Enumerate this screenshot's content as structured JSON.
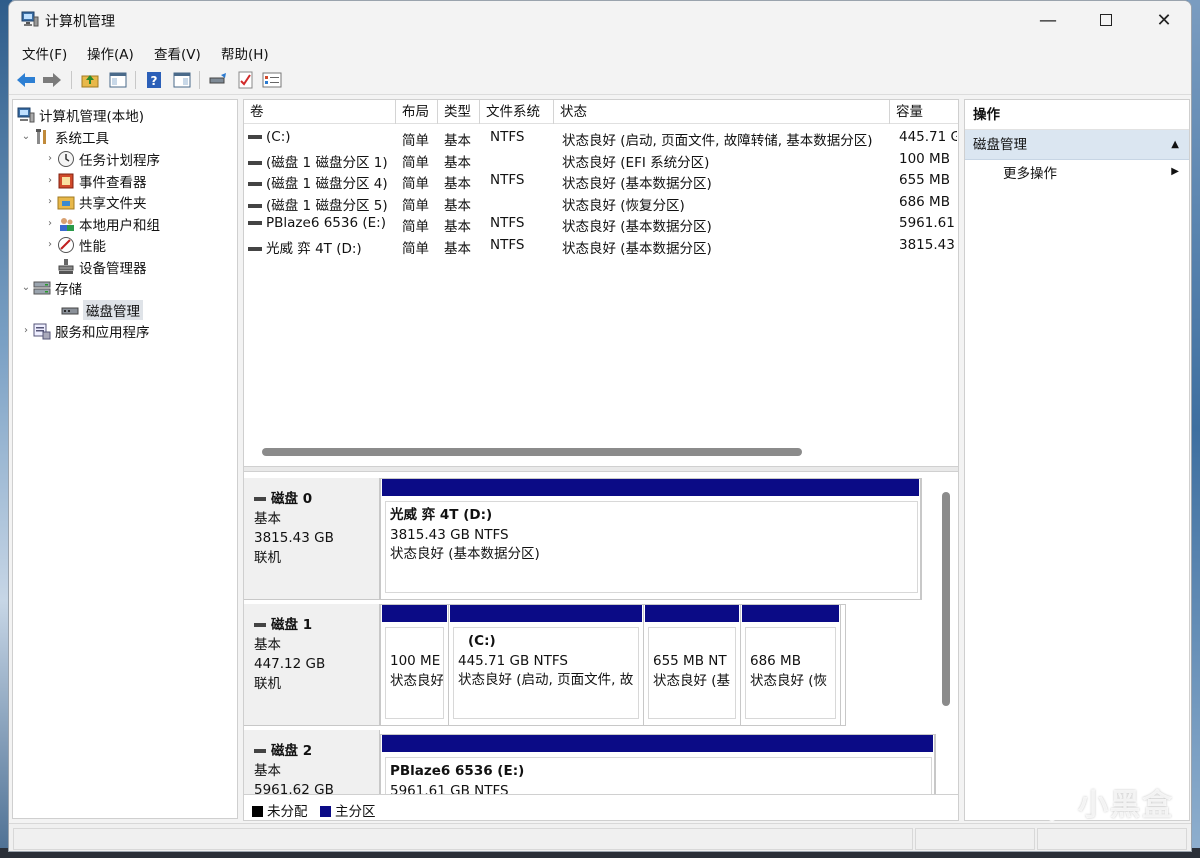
{
  "window": {
    "title": "计算机管理"
  },
  "menu": [
    "文件(F)",
    "操作(A)",
    "查看(V)",
    "帮助(H)"
  ],
  "tree": {
    "root": "计算机管理(本地)",
    "system_tools": "系统工具",
    "task_scheduler": "任务计划程序",
    "event_viewer": "事件查看器",
    "shared_folders": "共享文件夹",
    "local_users": "本地用户和组",
    "performance": "性能",
    "device_manager": "设备管理器",
    "storage": "存储",
    "disk_management": "磁盘管理",
    "services_apps": "服务和应用程序"
  },
  "volume_table": {
    "headers": [
      "卷",
      "布局",
      "类型",
      "文件系统",
      "状态",
      "容量"
    ],
    "rows": [
      {
        "volume": "(C:)",
        "layout": "简单",
        "type": "基本",
        "fs": "NTFS",
        "status": "状态良好 (启动, 页面文件, 故障转储, 基本数据分区)",
        "capacity": "445.71 G"
      },
      {
        "volume": "(磁盘 1 磁盘分区 1)",
        "layout": "简单",
        "type": "基本",
        "fs": "",
        "status": "状态良好 (EFI 系统分区)",
        "capacity": "100 MB"
      },
      {
        "volume": "(磁盘 1 磁盘分区 4)",
        "layout": "简单",
        "type": "基本",
        "fs": "NTFS",
        "status": "状态良好 (基本数据分区)",
        "capacity": "655 MB"
      },
      {
        "volume": "(磁盘 1 磁盘分区 5)",
        "layout": "简单",
        "type": "基本",
        "fs": "",
        "status": "状态良好 (恢复分区)",
        "capacity": "686 MB"
      },
      {
        "volume": "PBlaze6 6536 (E:)",
        "layout": "简单",
        "type": "基本",
        "fs": "NTFS",
        "status": "状态良好 (基本数据分区)",
        "capacity": "5961.61"
      },
      {
        "volume": "光威 弈 4T (D:)",
        "layout": "简单",
        "type": "基本",
        "fs": "NTFS",
        "status": "状态良好 (基本数据分区)",
        "capacity": "3815.43"
      }
    ]
  },
  "disks": {
    "d0": {
      "name": "磁盘 0",
      "type": "基本",
      "size": "3815.43 GB",
      "state": "联机",
      "p0": {
        "title": "光威 弈 4T  (D:)",
        "line1": "3815.43 GB NTFS",
        "line2": "状态良好 (基本数据分区)"
      }
    },
    "d1": {
      "name": "磁盘 1",
      "type": "基本",
      "size": "447.12 GB",
      "state": "联机",
      "p0": {
        "title": "",
        "line1": "100 ME",
        "line2": "状态良好"
      },
      "p1": {
        "title": "(C:)",
        "line1": "445.71 GB NTFS",
        "line2": "状态良好 (启动, 页面文件, 故"
      },
      "p2": {
        "title": "",
        "line1": "655 MB NT",
        "line2": "状态良好 (基"
      },
      "p3": {
        "title": "",
        "line1": "686 MB",
        "line2": "状态良好 (恢"
      }
    },
    "d2": {
      "name": "磁盘 2",
      "type": "基本",
      "size": "5961.62 GB",
      "state": "",
      "p0": {
        "title": "PBlaze6 6536  (E:)",
        "line1": "5961.61 GB NTFS",
        "line2": ""
      }
    }
  },
  "legend": {
    "unallocated": "未分配",
    "primary": "主分区",
    "unallocated_color": "#000000",
    "primary_color": "#0b0b86"
  },
  "actions": {
    "header": "操作",
    "section": "磁盘管理",
    "more": "更多操作"
  },
  "watermark": "小黑盒"
}
